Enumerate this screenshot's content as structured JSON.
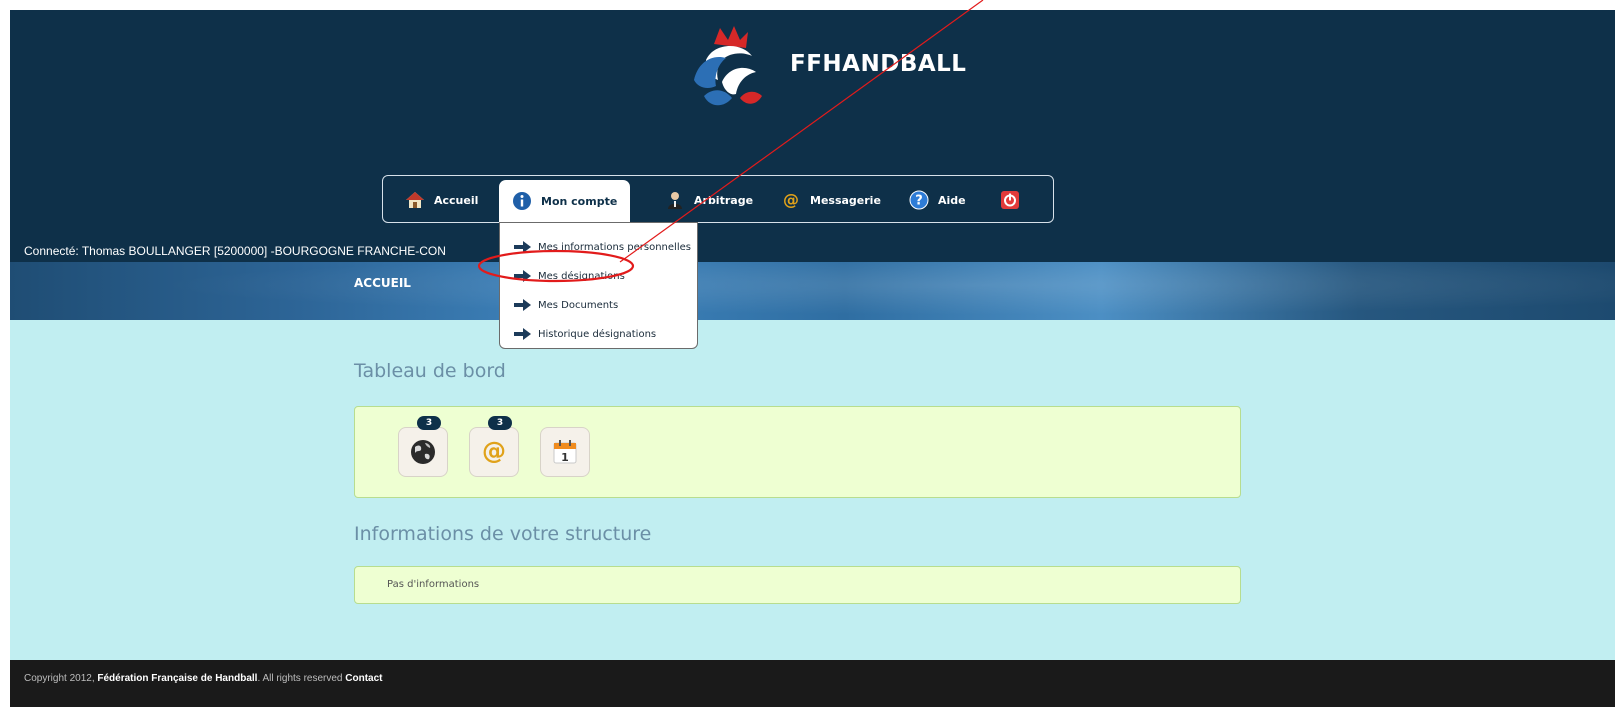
{
  "header": {
    "logo_text": "FFHANDBALL"
  },
  "nav": {
    "items": [
      {
        "label": "Accueil",
        "icon": "home-icon"
      },
      {
        "label": "Mon compte",
        "icon": "info-icon"
      },
      {
        "label": "Arbitrage",
        "icon": "referee-icon"
      },
      {
        "label": "Messagerie",
        "icon": "at-icon"
      },
      {
        "label": "Aide",
        "icon": "help-icon"
      },
      {
        "label": "",
        "icon": "power-icon"
      }
    ]
  },
  "dropdown": {
    "items": [
      {
        "label": "Mes informations personnelles"
      },
      {
        "label": "Mes désignations"
      },
      {
        "label": "Mes Documents"
      },
      {
        "label": "Historique désignations"
      }
    ]
  },
  "user": {
    "connected_text": "Connecté: Thomas BOULLANGER [5200000] -BOURGOGNE FRANCHE-CON"
  },
  "banner": {
    "title": "ACCUEIL"
  },
  "dashboard": {
    "title": "Tableau de bord",
    "tiles": [
      {
        "icon": "globe-icon",
        "badge": "3"
      },
      {
        "icon": "at-icon",
        "badge": "3"
      },
      {
        "icon": "calendar-icon",
        "badge": ""
      }
    ],
    "calendar_day": "1"
  },
  "structure": {
    "title": "Informations de votre structure",
    "empty_text": "Pas d'informations"
  },
  "footer": {
    "prefix": "Copyright 2012, ",
    "org": "Fédération Française de Handball",
    "middle": ". All rights reserved ",
    "contact": "Contact"
  },
  "colors": {
    "header_bg": "#0e3049",
    "page_bg": "#c1eef1",
    "panel_bg": "#eeffd2",
    "annotation": "#e21b1b"
  }
}
